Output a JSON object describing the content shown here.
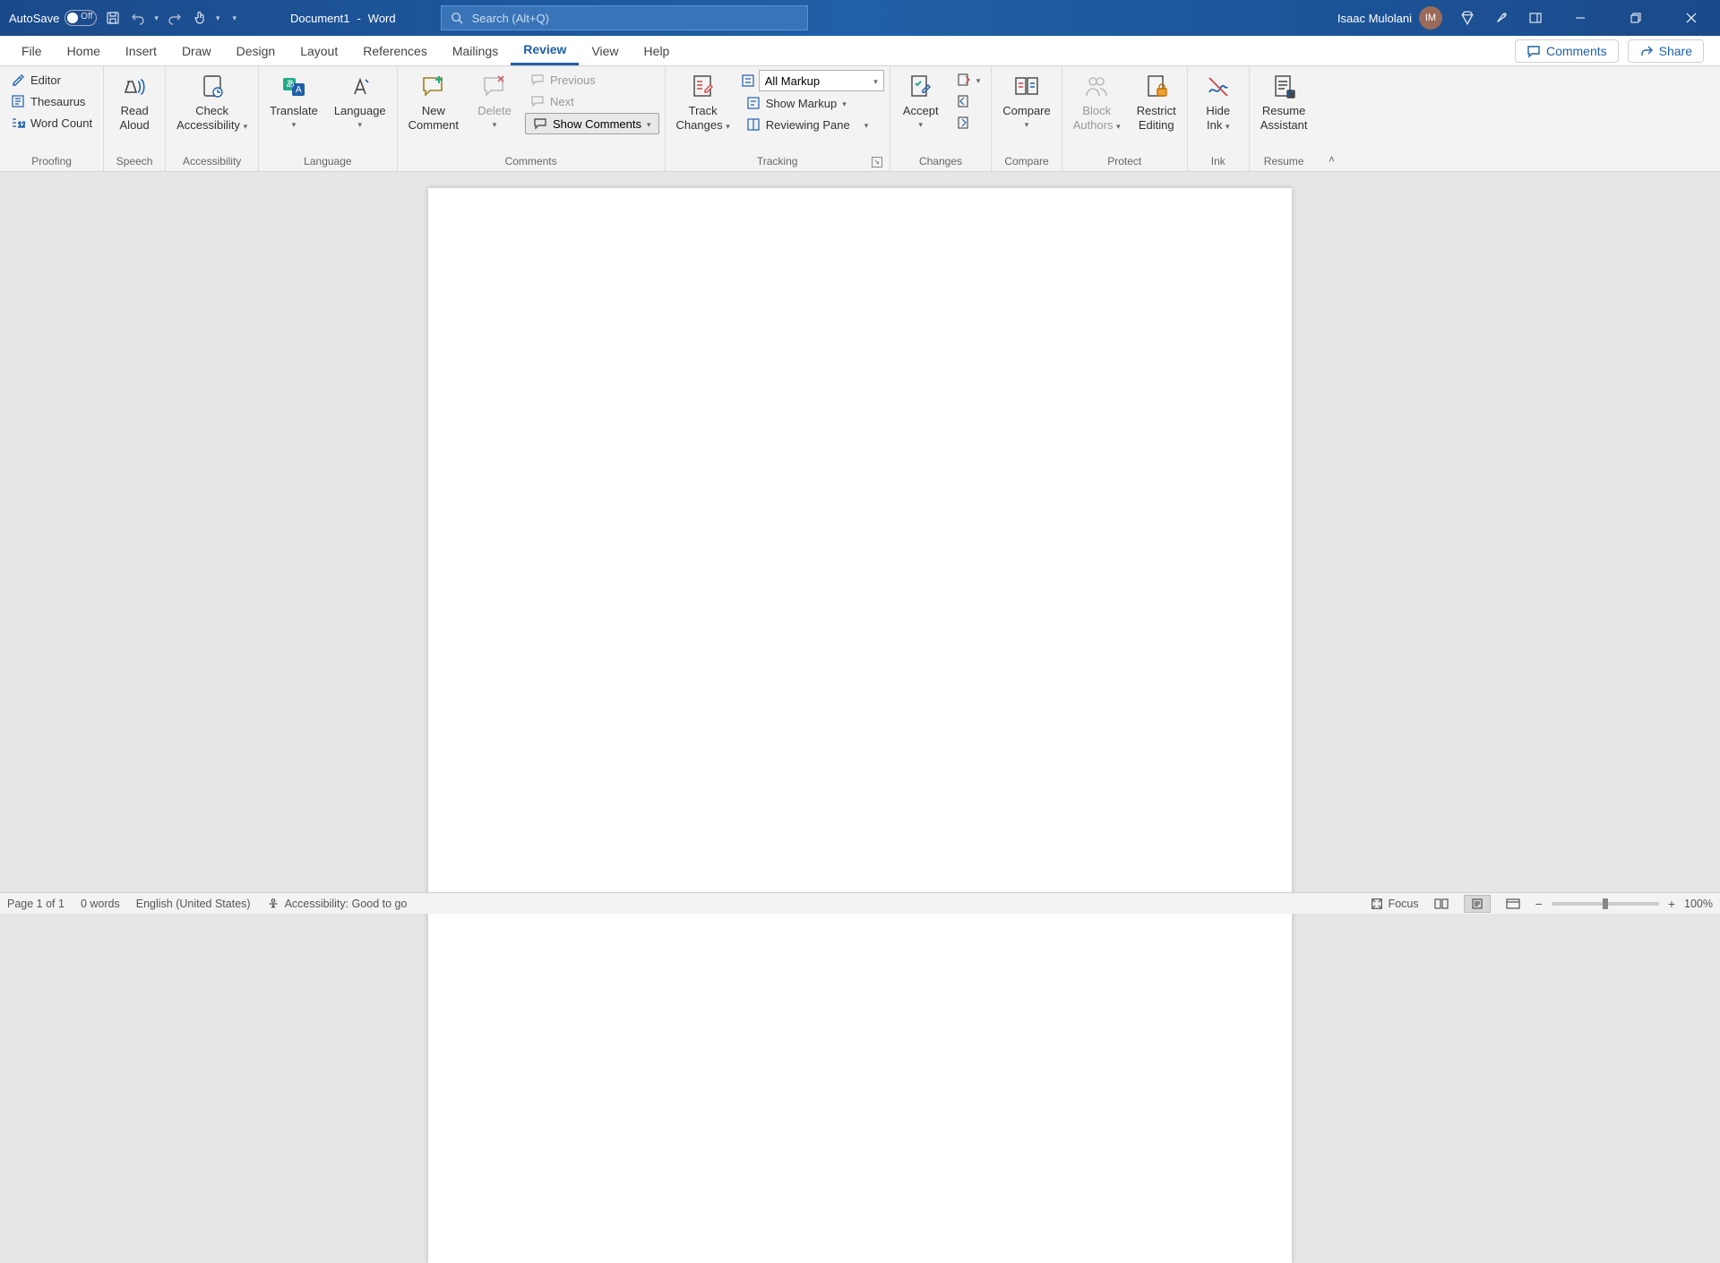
{
  "titlebar": {
    "autosave_label": "AutoSave",
    "autosave_state": "Off",
    "doc_name": "Document1",
    "sep": "-",
    "app_name": "Word",
    "search_placeholder": "Search (Alt+Q)",
    "user_name": "Isaac Mulolani",
    "user_initials": "IM"
  },
  "tabs": {
    "items": [
      "File",
      "Home",
      "Insert",
      "Draw",
      "Design",
      "Layout",
      "References",
      "Mailings",
      "Review",
      "View",
      "Help"
    ],
    "active": "Review",
    "comments_btn": "Comments",
    "share_btn": "Share"
  },
  "ribbon": {
    "proofing": {
      "label": "Proofing",
      "editor": "Editor",
      "thesaurus": "Thesaurus",
      "word_count": "Word Count"
    },
    "speech": {
      "label": "Speech",
      "read_aloud_l1": "Read",
      "read_aloud_l2": "Aloud"
    },
    "accessibility": {
      "label": "Accessibility",
      "check_l1": "Check",
      "check_l2": "Accessibility"
    },
    "language": {
      "label": "Language",
      "translate": "Translate",
      "language_btn": "Language"
    },
    "comments": {
      "label": "Comments",
      "new_l1": "New",
      "new_l2": "Comment",
      "delete": "Delete",
      "previous": "Previous",
      "next": "Next",
      "show_comments": "Show Comments"
    },
    "tracking": {
      "label": "Tracking",
      "track_l1": "Track",
      "track_l2": "Changes",
      "markup_mode": "All Markup",
      "show_markup": "Show Markup",
      "reviewing_pane": "Reviewing Pane"
    },
    "changes": {
      "label": "Changes",
      "accept": "Accept"
    },
    "compare": {
      "label": "Compare",
      "compare_btn": "Compare"
    },
    "protect": {
      "label": "Protect",
      "block_l1": "Block",
      "block_l2": "Authors",
      "restrict_l1": "Restrict",
      "restrict_l2": "Editing"
    },
    "ink": {
      "label": "Ink",
      "hide_l1": "Hide",
      "hide_l2": "Ink"
    },
    "resume": {
      "label": "Resume",
      "resume_l1": "Resume",
      "resume_l2": "Assistant"
    }
  },
  "statusbar": {
    "page": "Page 1 of 1",
    "words": "0 words",
    "lang": "English (United States)",
    "accessibility": "Accessibility: Good to go",
    "focus": "Focus",
    "zoom_pct": "100%"
  }
}
